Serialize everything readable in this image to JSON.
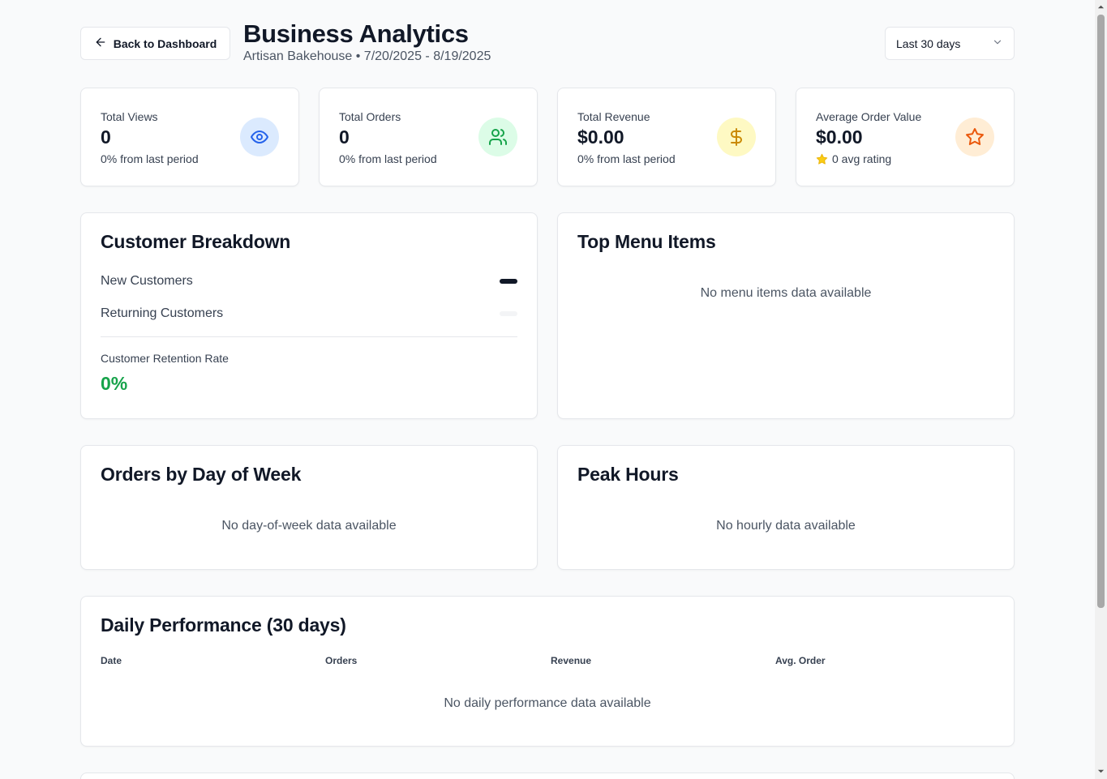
{
  "header": {
    "back_label": "Back to Dashboard",
    "title": "Business Analytics",
    "subtitle": "Artisan Bakehouse • 7/20/2025 - 8/19/2025",
    "range_selected": "Last 30 days"
  },
  "stats": [
    {
      "label": "Total Views",
      "value": "0",
      "change": "0% from last period",
      "icon": "eye-icon",
      "bg": "#dbeafe",
      "fg": "#2563eb"
    },
    {
      "label": "Total Orders",
      "value": "0",
      "change": "0% from last period",
      "icon": "users-icon",
      "bg": "#dcfce7",
      "fg": "#16a34a"
    },
    {
      "label": "Total Revenue",
      "value": "$0.00",
      "change": "0% from last period",
      "icon": "dollar-icon",
      "bg": "#fef9c3",
      "fg": "#ca8a04"
    },
    {
      "label": "Average Order Value",
      "value": "$0.00",
      "change": "0 avg rating",
      "icon": "star-icon",
      "bg": "#ffedd5",
      "fg": "#ea580c"
    }
  ],
  "customer_breakdown": {
    "title": "Customer Breakdown",
    "new_label": "New Customers",
    "returning_label": "Returning Customers",
    "retention_label": "Customer Retention Rate",
    "retention_value": "0%"
  },
  "top_menu": {
    "title": "Top Menu Items",
    "empty": "No menu items data available"
  },
  "orders_by_day": {
    "title": "Orders by Day of Week",
    "empty": "No day-of-week data available"
  },
  "peak_hours": {
    "title": "Peak Hours",
    "empty": "No hourly data available"
  },
  "daily_performance": {
    "title": "Daily Performance (30 days)",
    "columns": [
      "Date",
      "Orders",
      "Revenue",
      "Avg. Order"
    ],
    "empty": "No daily performance data available"
  }
}
